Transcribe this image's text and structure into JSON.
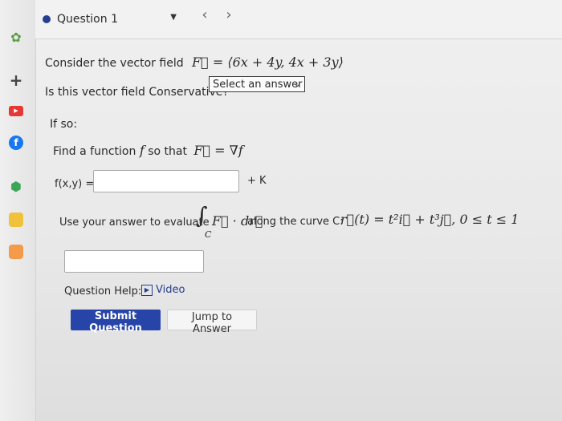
{
  "question_nav": {
    "title": "Question 1",
    "prev_icon": "chevron-left",
    "next_icon": "chevron-right"
  },
  "problem": {
    "intro": "Consider the vector field",
    "field": "F⃗ = ⟨6x + 4y, 4x + 3y⟩",
    "conservative_prompt": "Is this vector field Conservative?",
    "select_value": "Select an answer",
    "if_so": "If so:",
    "find_prompt_pre": "Find a function",
    "find_prompt_f": "f",
    "find_prompt_post": "so that",
    "find_relation": "F⃗ = ∇f",
    "f_label": "f(x,y) =",
    "plus_k": "+ K",
    "evaluate_pre": "Use your answer to evaluate",
    "integral_expr": "∫",
    "integral_sub": "C",
    "integral_body": "F⃗ · dr⃗",
    "curve_text": "along the curve C:",
    "curve_expr": "r⃗(t) = t²i⃗ + t³j⃗,  0 ≤ t ≤ 1"
  },
  "help": {
    "label": "Question Help:",
    "video": "Video"
  },
  "buttons": {
    "submit": "Submit Question",
    "jump": "Jump to Answer"
  },
  "colors": {
    "primary": "#2745a8",
    "accent_dot": "#243f8f"
  }
}
